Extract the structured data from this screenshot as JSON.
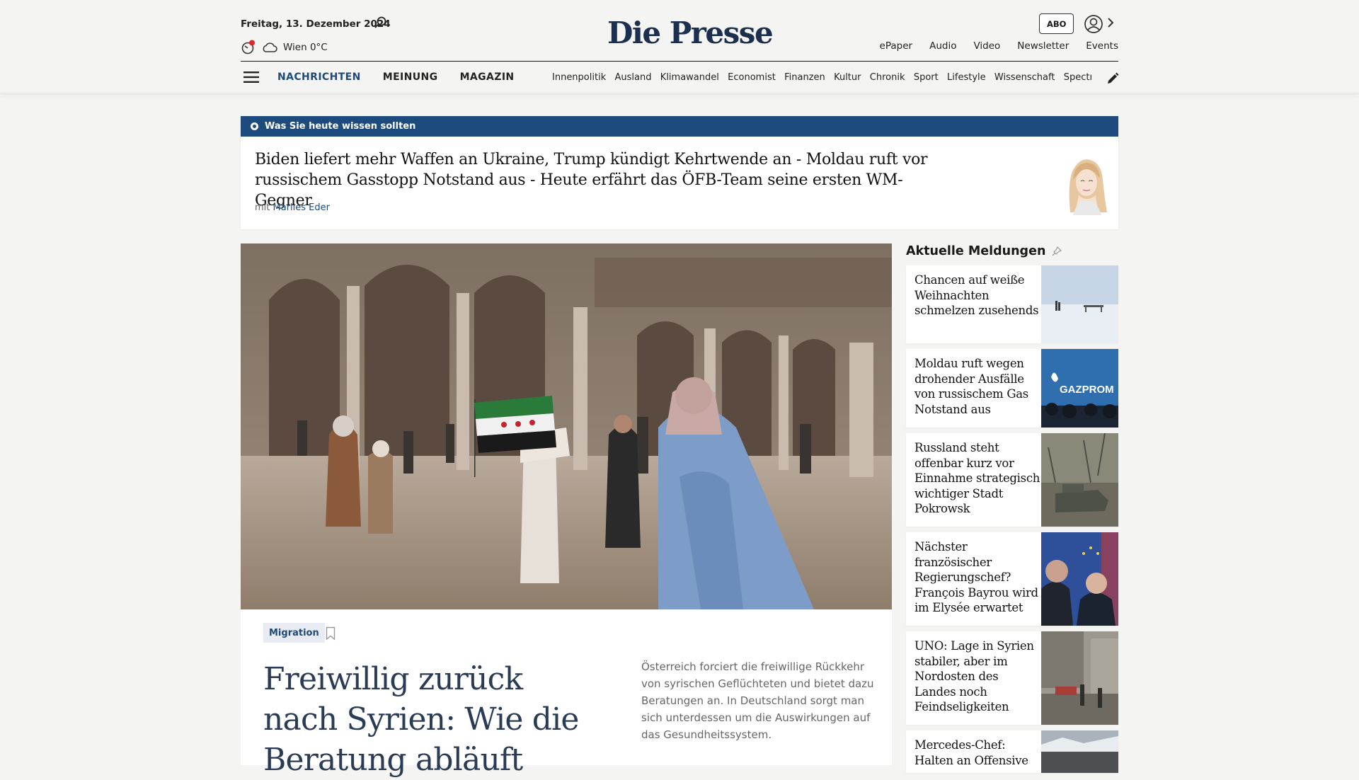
{
  "header": {
    "date": "Freitag, 13. Dezember 2024",
    "weather": "Wien 0°C",
    "logo": "Die Presse",
    "abo_label": "ABO",
    "topnav": [
      "ePaper",
      "Audio",
      "Video",
      "Newsletter",
      "Events"
    ],
    "sections": [
      {
        "label": "NACHRICHTEN",
        "active": true
      },
      {
        "label": "MEINUNG",
        "active": false
      },
      {
        "label": "MAGAZIN",
        "active": false
      }
    ],
    "subnav": [
      "Innenpolitik",
      "Ausland",
      "Klimawandel",
      "Economist",
      "Finanzen",
      "Kultur",
      "Chronik",
      "Sport",
      "Lifestyle",
      "Wissenschaft",
      "Spectrum"
    ],
    "icons": [
      "search-icon",
      "timer-icon",
      "cloud-icon",
      "user-icon",
      "chevron-right-icon",
      "menu-icon",
      "edit-icon"
    ],
    "accent_color": "#1d4a7a",
    "notification_color": "#e0262f"
  },
  "briefing": {
    "label": "Was Sie heute wissen sollten",
    "headline": "Biden liefert mehr Waffen an Ukraine, Trump kündigt Kehrtwende an - Moldau ruft vor russischem Gasstopp Notstand aus - Heute erfährt das ÖFB-Team seine ersten WM-Gegner",
    "by_prefix": "mit",
    "author": "Marlies Eder",
    "bar_color": "#1d4b7d"
  },
  "lead": {
    "tag": "Migration",
    "title": "Freiwillig zurück nach Syrien: Wie die Beratung abläuft",
    "teaser": "Österreich forciert die freiwillige Rückkehr von syrischen Geflüchteten und bietet dazu Beratungen an. In Deutschland sorgt man sich unterdessen um die Auswirkungen auf das Gesundheitssystem."
  },
  "news": {
    "heading": "Aktuelle Meldungen",
    "items": [
      {
        "title": "Chancen auf weiße Weihnachten schmelzen zusehends"
      },
      {
        "title": "Moldau ruft wegen drohender Ausfälle von russischem Gas Notstand aus",
        "thumb_text": "GAZPROM"
      },
      {
        "title": "Russland steht offenbar kurz vor Einnahme strategisch wichtiger Stadt Pokrowsk"
      },
      {
        "title": "Nächster französischer Regierungschef? François Bayrou wird im Elysée erwartet"
      },
      {
        "title": "UNO: Lage in Syrien stabiler, aber im Nordosten des Landes noch Feindseligkeiten"
      },
      {
        "title": "Mercedes-Chef: Halten an Offensive"
      }
    ]
  }
}
